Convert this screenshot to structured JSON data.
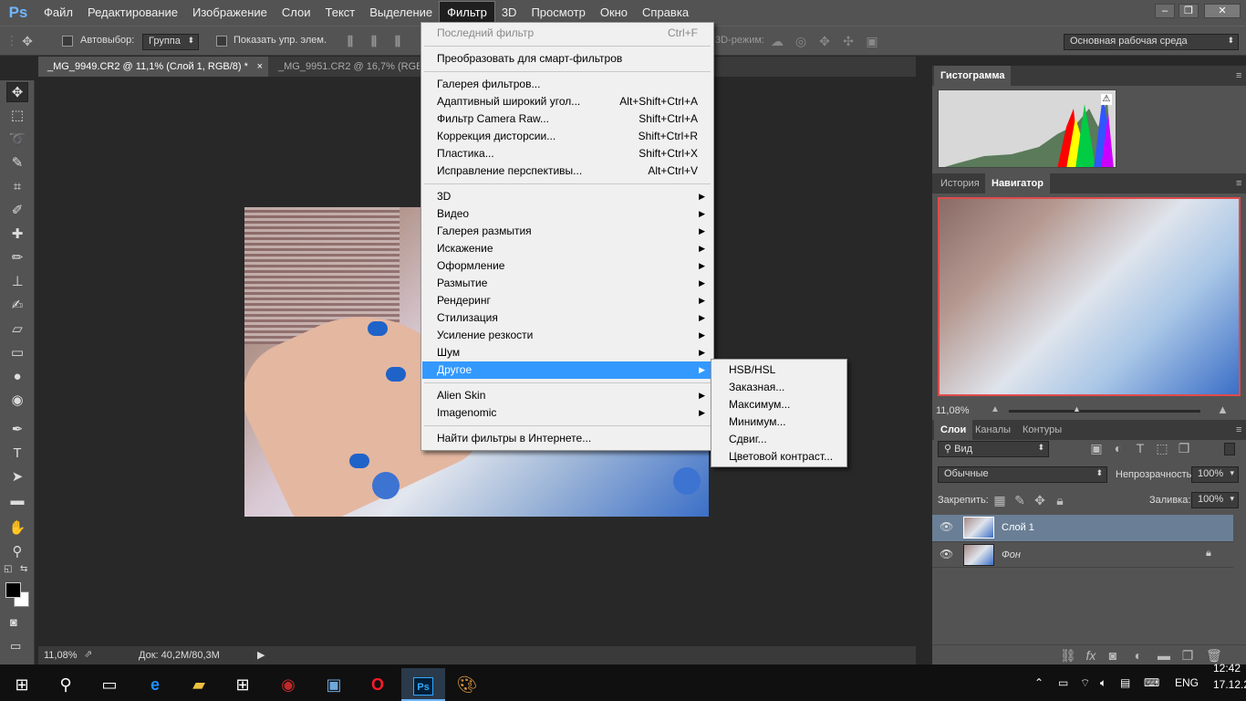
{
  "app": {
    "logo": "Ps"
  },
  "menubar": {
    "items": [
      "Файл",
      "Редактирование",
      "Изображение",
      "Слои",
      "Текст",
      "Выделение",
      "Фильтр",
      "3D",
      "Просмотр",
      "Окно",
      "Справка"
    ],
    "active_index": 6
  },
  "window_controls": {
    "minimize": "–",
    "restore": "❐",
    "close": "✕"
  },
  "options_bar": {
    "autoselect_label": "Автовыбор:",
    "autoselect_value": "Группа",
    "show_controls_label": "Показать упр. элем.",
    "mode3d_label": "3D-режим:",
    "workspace_value": "Основная рабочая среда"
  },
  "doc_tabs": [
    {
      "label": "_MG_9949.CR2 @ 11,1% (Слой 1, RGB/8) *",
      "close": "×"
    },
    {
      "label": "_MG_9951.CR2 @ 16,7% (RGB/"
    }
  ],
  "tools": [
    {
      "name": "move-tool-icon",
      "glyph": "✥"
    },
    {
      "name": "marquee-tool-icon",
      "glyph": "⬚"
    },
    {
      "name": "lasso-tool-icon",
      "glyph": "➰"
    },
    {
      "name": "quick-select-tool-icon",
      "glyph": "✎"
    },
    {
      "name": "crop-tool-icon",
      "glyph": "⌗"
    },
    {
      "name": "eyedropper-tool-icon",
      "glyph": "✐"
    },
    {
      "name": "healing-brush-tool-icon",
      "glyph": "✚"
    },
    {
      "name": "brush-tool-icon",
      "glyph": "✏"
    },
    {
      "name": "clone-stamp-tool-icon",
      "glyph": "⊥"
    },
    {
      "name": "history-brush-tool-icon",
      "glyph": "✍"
    },
    {
      "name": "eraser-tool-icon",
      "glyph": "▱"
    },
    {
      "name": "gradient-tool-icon",
      "glyph": "▭"
    },
    {
      "name": "blur-tool-icon",
      "glyph": "●"
    },
    {
      "name": "dodge-tool-icon",
      "glyph": "◉"
    },
    {
      "name": "pen-tool-icon",
      "glyph": "✒"
    },
    {
      "name": "type-tool-icon",
      "glyph": "T"
    },
    {
      "name": "path-select-tool-icon",
      "glyph": "➤"
    },
    {
      "name": "rectangle-tool-icon",
      "glyph": "▬"
    },
    {
      "name": "hand-tool-icon",
      "glyph": "✋"
    },
    {
      "name": "zoom-tool-icon",
      "glyph": "⚲"
    }
  ],
  "status_bar": {
    "zoom": "11,08%",
    "doc_info": "Док: 40,2M/80,3M"
  },
  "filter_menu": {
    "last_filter": {
      "label": "Последний фильтр",
      "shortcut": "Ctrl+F"
    },
    "smart": "Преобразовать для смарт-фильтров",
    "group1": [
      {
        "label": "Галерея фильтров...",
        "shortcut": ""
      },
      {
        "label": "Адаптивный широкий угол...",
        "shortcut": "Alt+Shift+Ctrl+A"
      },
      {
        "label": "Фильтр Camera Raw...",
        "shortcut": "Shift+Ctrl+A"
      },
      {
        "label": "Коррекция дисторсии...",
        "shortcut": "Shift+Ctrl+R"
      },
      {
        "label": "Пластика...",
        "shortcut": "Shift+Ctrl+X"
      },
      {
        "label": "Исправление перспективы...",
        "shortcut": "Alt+Ctrl+V"
      }
    ],
    "group2": [
      "3D",
      "Видео",
      "Галерея размытия",
      "Искажение",
      "Оформление",
      "Размытие",
      "Рендеринг",
      "Стилизация",
      "Усиление резкости",
      "Шум",
      "Другое"
    ],
    "group3": [
      "Alien Skin",
      "Imagenomic"
    ],
    "online": "Найти фильтры в Интернете..."
  },
  "submenu_other": [
    "HSB/HSL",
    "Заказная...",
    "Максимум...",
    "Минимум...",
    "Сдвиг...",
    "Цветовой контраст..."
  ],
  "histogram_panel": {
    "tab": "Гистограмма"
  },
  "navigator_panel": {
    "tabs": [
      "История",
      "Навигатор"
    ],
    "zoom": "11,08%"
  },
  "layers_panel": {
    "tabs": [
      "Слои",
      "Каналы",
      "Контуры"
    ],
    "kind_filter": "Вид",
    "blend_mode": "Обычные",
    "opacity_label": "Непрозрачность:",
    "opacity_value": "100%",
    "lock_label": "Закрепить:",
    "fill_label": "Заливка:",
    "fill_value": "100%",
    "layers": [
      {
        "name": "Слой 1",
        "selected": true,
        "locked": false
      },
      {
        "name": "Фон",
        "selected": false,
        "locked": true
      }
    ]
  },
  "taskbar": {
    "lang": "ENG",
    "time": "12:42",
    "date": "17.12.2"
  },
  "colors": {
    "accent": "#3399ff",
    "panel": "#535353",
    "dark": "#282828"
  }
}
